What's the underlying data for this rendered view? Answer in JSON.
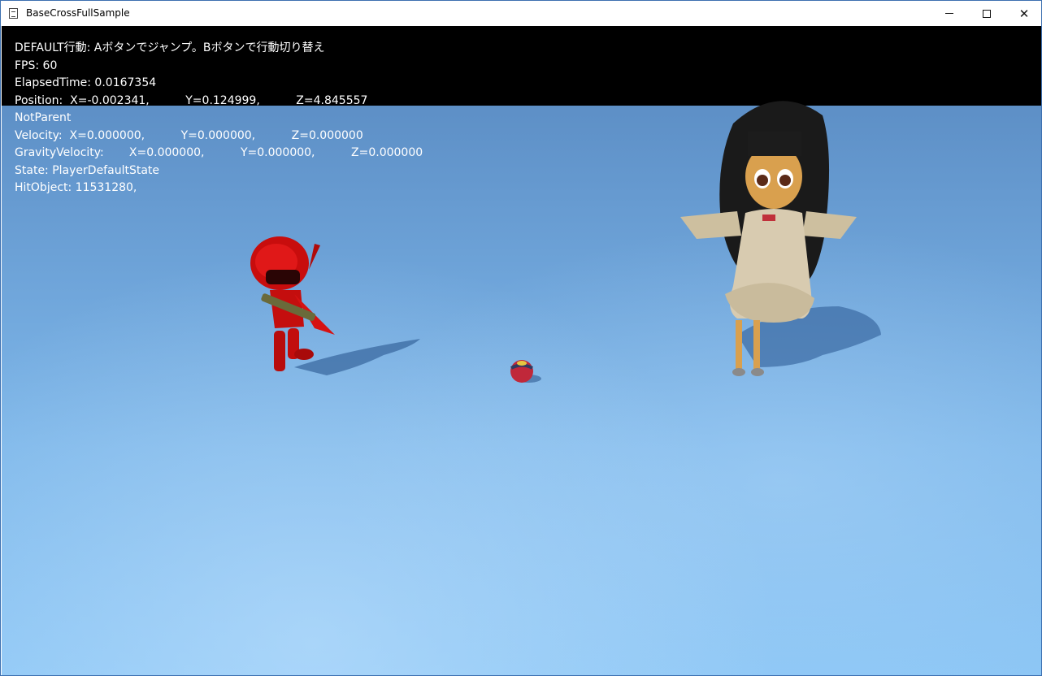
{
  "window": {
    "title": "BaseCrossFullSample",
    "controls": {
      "minimize": "—",
      "maximize": "☐",
      "close": "✕"
    }
  },
  "hud": {
    "line1": "DEFAULT行動: Aボタンでジャンプ。Bボタンで行動切り替え",
    "line2": "FPS: 60",
    "line3": "ElapsedTime: 0.0167354",
    "line4": "Position:  X=-0.002341,          Y=0.124999,          Z=4.845557",
    "line5": "NotParent",
    "line6": "Velocity:  X=0.000000,          Y=0.000000,          Z=0.000000",
    "line7": "GravityVelocity:       X=0.000000,          Y=0.000000,          Z=0.000000",
    "line8": "State: PlayerDefaultState",
    "line9": "HitObject: 11531280,"
  },
  "colors": {
    "sky_top": "#5d8fc6",
    "sky_bottom": "#8cc6f5",
    "robot_red": "#d01010",
    "ball_red": "#c0283a",
    "dress": "#d8cbb0",
    "hair": "#1a1a1a"
  },
  "scene": {
    "objects": [
      "red-robot-character",
      "ball-player",
      "girl-character"
    ]
  }
}
